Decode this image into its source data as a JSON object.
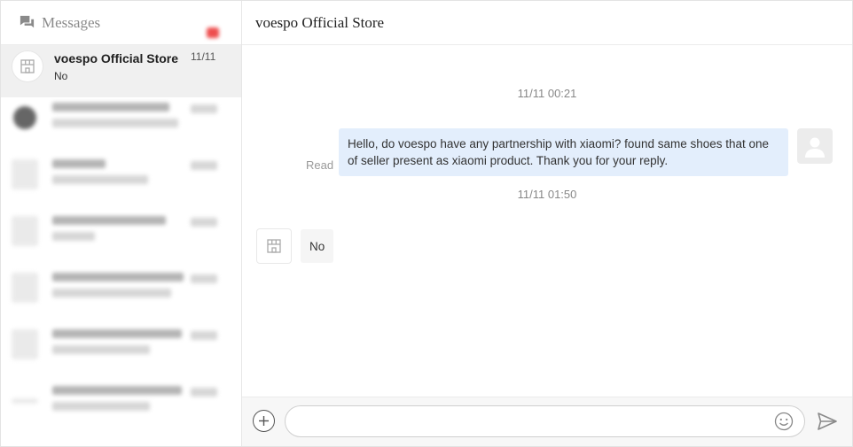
{
  "sidebar": {
    "title": "Messages",
    "icon": "chat-bubbles-icon",
    "active_conversation": {
      "name": "voespo Official Store",
      "preview": "No",
      "date": "11/11",
      "avatar_icon": "store-icon"
    }
  },
  "main": {
    "store_title": "voespo Official Store"
  },
  "chat": {
    "messages": [
      {
        "type": "timestamp",
        "text": "11/11 00:21"
      },
      {
        "type": "outgoing",
        "text": "Hello, do voespo have any partnership with xiaomi? found same shoes that one of seller present as xiaomi product. Thank you for your reply.",
        "status": "Read"
      },
      {
        "type": "timestamp",
        "text": "11/11 01:50"
      },
      {
        "type": "incoming",
        "text": "No"
      }
    ]
  },
  "composer": {
    "placeholder": "",
    "plus_icon": "plus-icon",
    "emoji_icon": "emoji-icon",
    "send_icon": "send-icon"
  },
  "colors": {
    "outgoing_bubble": "#e3eefc",
    "incoming_bubble": "#f5f5f5",
    "active_conversation_bg": "#f0f0f0",
    "unread_badge": "#ee4d4d"
  }
}
